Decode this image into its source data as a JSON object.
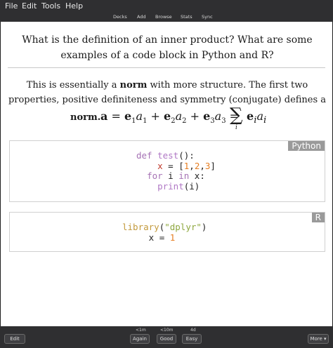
{
  "menu": {
    "file": "File",
    "edit": "Edit",
    "tools": "Tools",
    "help": "Help"
  },
  "nav": {
    "decks": "Decks",
    "add": "Add",
    "browse": "Browse",
    "stats": "Stats",
    "sync": "Sync"
  },
  "card": {
    "question": "What is the definition of an inner product? What are some examples of a code block in Python and R?",
    "answer_pre": "This is essentially a ",
    "answer_norm1": "norm",
    "answer_post": " with more structure. The first two properties, positive definiteness and symmetry (conjugate) defines a",
    "answer_norm2": "norm."
  },
  "code_python": {
    "lang": "Python",
    "l1_kw": "def",
    "l1_fn": "test",
    "l1_rest": "():",
    "l2_var": "x",
    "l2_eq": " = [",
    "l2_n1": "1",
    "l2_c1": ",",
    "l2_n2": "2",
    "l2_c2": ",",
    "l2_n3": "3",
    "l2_end": "]",
    "l3_kw1": "for",
    "l3_mid": " i ",
    "l3_kw2": "in",
    "l3_end": " x:",
    "l4_fn": "print",
    "l4_end": "(i)"
  },
  "code_r": {
    "lang": "R",
    "l1_fn": "library",
    "l1_open": "(",
    "l1_str": "\"dplyr\"",
    "l1_close": ")",
    "l2_var": "x",
    "l2_eq": " = ",
    "l2_num": "1"
  },
  "bottom": {
    "again_time": "<1m",
    "good_time": "<10m",
    "easy_time": "4d",
    "edit": "Edit",
    "again": "Again",
    "good": "Good",
    "easy": "Easy",
    "more": "More"
  }
}
